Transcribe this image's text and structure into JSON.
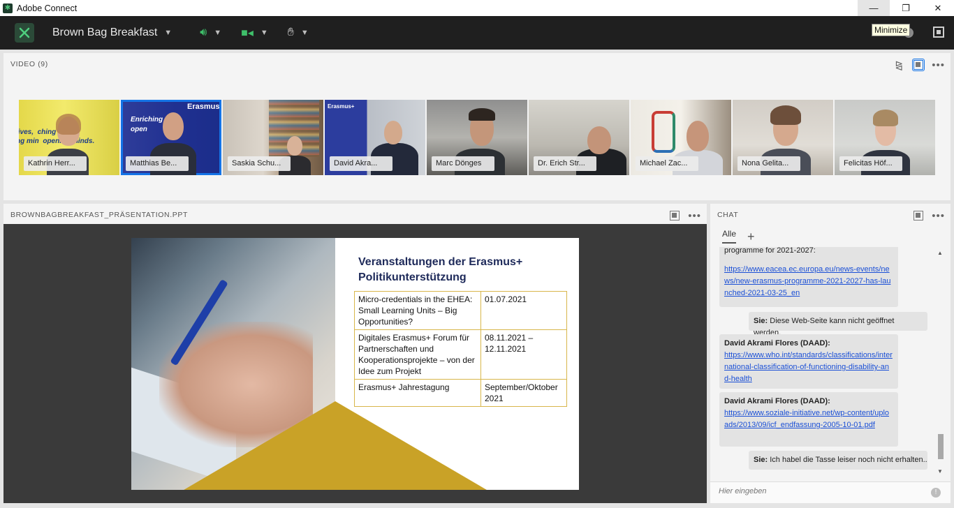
{
  "window": {
    "title": "Adobe Connect",
    "minimize": "—",
    "restore": "❐",
    "close": "✕",
    "tooltip": "Minimize"
  },
  "toolbar": {
    "meeting_name": "Brown Bag Breakfast",
    "audio_icon": "speaker-icon",
    "camera_icon": "camera-icon",
    "raise_hand_icon": "hand-icon"
  },
  "video_pod": {
    "title": "VIDEO (9)",
    "participants": [
      {
        "name": "Kathrin Herr..."
      },
      {
        "name": "Matthias Be..."
      },
      {
        "name": "Saskia Schu..."
      },
      {
        "name": "David Akra..."
      },
      {
        "name": "Marc Dönges"
      },
      {
        "name": "Dr. Erich Str..."
      },
      {
        "name": "Michael Zac..."
      },
      {
        "name": "Nona Gelita..."
      },
      {
        "name": "Felicitas Höf..."
      }
    ],
    "tile_texts": {
      "t1": "lives,  ching lives,\nng min  opening minds.",
      "t2_brand": "Erasmus",
      "t2_text": "Enriching\nopen",
      "t4_brand": "Erasmus+"
    }
  },
  "presentation_pod": {
    "title": "BROWNBAGBREAKFAST_PRÄSENTATION.PPT",
    "slide": {
      "title_line1": "Veranstaltungen der Erasmus+",
      "title_line2": "Politikunterstützung",
      "rows": [
        {
          "event": "Micro-credentials in the EHEA: Small Learning Units – Big Opportunities?",
          "date": "01.07.2021"
        },
        {
          "event": "Digitales Erasmus+ Forum für Partnerschaften und Kooperationsprojekte – von der Idee zum Projekt",
          "date": "08.11.2021 – 12.11.2021"
        },
        {
          "event": "Erasmus+ Jahrestagung",
          "date": "September/Oktober 2021"
        }
      ]
    }
  },
  "chat_pod": {
    "title": "CHAT",
    "tab_all": "Alle",
    "add_tab": "+",
    "messages": [
      {
        "text": "programme for 2021-2027:"
      },
      {
        "link": "https://www.eacea.ec.europa.eu/news-events/news/new-erasmus-programme-2021-2027-has-launched-2021-03-25_en"
      },
      {
        "sender": "Sie:",
        "text": "Diese Web-Seite kann nicht geöffnet werden."
      },
      {
        "sender": "David Akrami Flores (DAAD):",
        "link": "https://www.who.int/standards/classifications/international-classification-of-functioning-disability-and-health"
      },
      {
        "sender": "David Akrami Flores (DAAD):",
        "link": "https://www.soziale-initiative.net/wp-content/uploads/2013/09/icf_endfassung-2005-10-01.pdf"
      },
      {
        "sender": "Sie:",
        "text": "Ich habel die Tasse leiser noch nicht erhalten..."
      }
    ],
    "input_placeholder": "Hier eingeben"
  }
}
